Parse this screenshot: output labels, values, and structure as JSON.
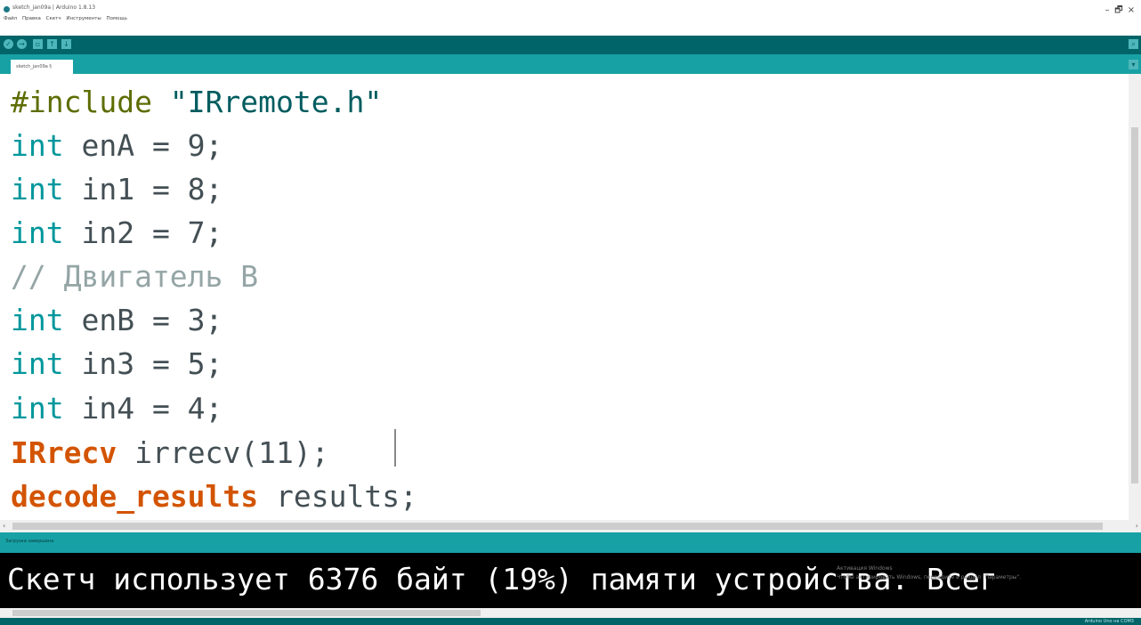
{
  "window": {
    "title": "sketch_jan09a | Arduino 1.8.13",
    "controls": {
      "minimize": "–",
      "maximize": "🗗",
      "close": "×"
    }
  },
  "menu": [
    "Файл",
    "Правка",
    "Скетч",
    "Инструменты",
    "Помощь"
  ],
  "toolbar": {
    "buttons": [
      {
        "name": "verify",
        "icon": "check-icon",
        "glyph": "✓"
      },
      {
        "name": "upload",
        "icon": "arrow-right-icon",
        "glyph": "→"
      },
      {
        "name": "new",
        "icon": "new-file-icon",
        "glyph": "▫"
      },
      {
        "name": "open",
        "icon": "open-icon",
        "glyph": "↑"
      },
      {
        "name": "save",
        "icon": "save-icon",
        "glyph": "↓"
      }
    ],
    "serial_monitor_icon": "magnifier-icon",
    "serial_monitor_glyph": "⌕"
  },
  "tabs": [
    {
      "label": "sketch_jan09a §"
    }
  ],
  "tab_menu_glyph": "▾",
  "code": {
    "line1": {
      "directive": "#include",
      "string": "\"IRremote.h\""
    },
    "line2": {
      "type": "int",
      "rest": " enA = 9;"
    },
    "line3": {
      "type": "int",
      "rest": " in1 = 8;"
    },
    "line4": {
      "type": "int",
      "rest": " in2 = 7;"
    },
    "line5": {
      "comment": "// Двигатель В"
    },
    "line6": {
      "type": "int",
      "rest": " enB = 3;"
    },
    "line7": {
      "type": "int",
      "rest": " in3 = 5;"
    },
    "line8": {
      "type": "int",
      "rest": " in4 = 4;"
    },
    "line9": {
      "class": "IRrecv",
      "rest": " irrecv(11);"
    },
    "line10": {
      "class": "decode_results",
      "rest": " results;"
    }
  },
  "status": {
    "message": "Загрузка завершена"
  },
  "console": {
    "text": "Скетч использует 6376 байт (19%) памяти устройства. Всег",
    "watermark_line1": "Активация Windows",
    "watermark_line2": "Чтобы активировать Windows, перейдите в раздел \"Параметры\"."
  },
  "footer": {
    "board": "Arduino Uno на COM3"
  },
  "colors": {
    "toolbar": "#006468",
    "tabbar": "#17a1a5",
    "keyword_type": "#00979c",
    "keyword_class": "#d35400",
    "comment": "#95a5a6",
    "console_bg": "#000000"
  }
}
